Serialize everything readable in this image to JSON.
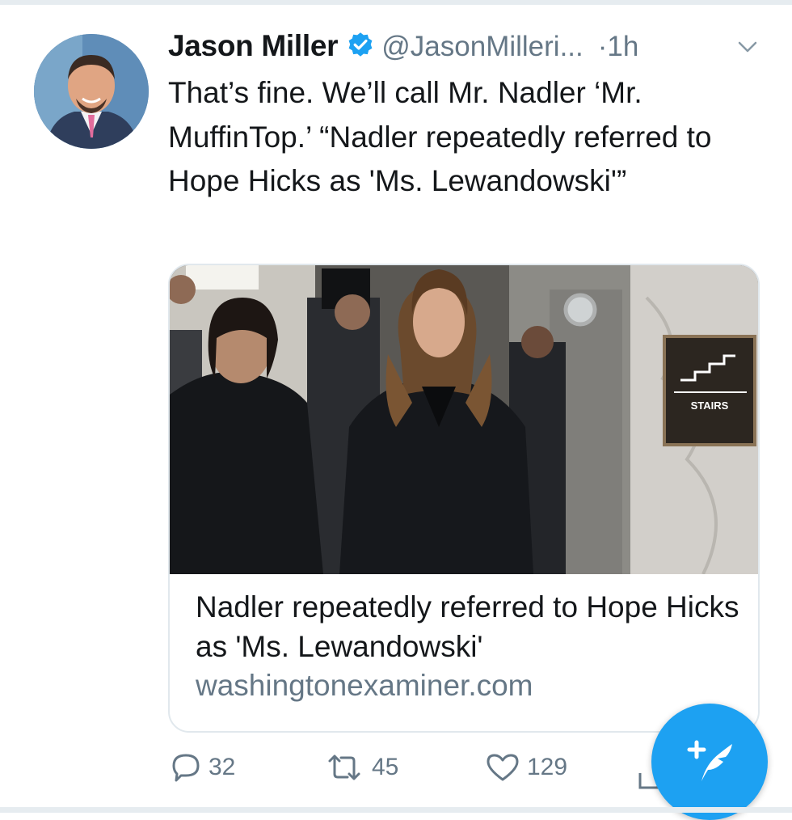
{
  "tweet": {
    "author_name": "Jason Miller",
    "author_handle": "@JasonMilleri...",
    "separator": "·",
    "time": "1h",
    "text": "That’s fine. We’ll call Mr. Nadler ‘Mr. MuffinTop.’ “Nadler repeatedly referred to Hope Hicks as 'Ms. Lewandowski'”",
    "card": {
      "title": "Nadler repeatedly referred to Hope Hicks as 'Ms. Lewandowski'",
      "domain": "washingtonexaminer.com",
      "sign_text": "STAIRS"
    },
    "counts": {
      "replies": "32",
      "retweets": "45",
      "likes": "129"
    }
  },
  "colors": {
    "accent": "#1da1f2",
    "text": "#14171a",
    "secondary": "#657786",
    "border": "#e1e8ed"
  },
  "icons": {
    "verified": "verified-badge-icon",
    "menu": "chevron-down-icon",
    "reply": "reply-icon",
    "retweet": "retweet-icon",
    "like": "heart-icon",
    "share": "share-icon",
    "compose": "compose-feather-icon"
  }
}
